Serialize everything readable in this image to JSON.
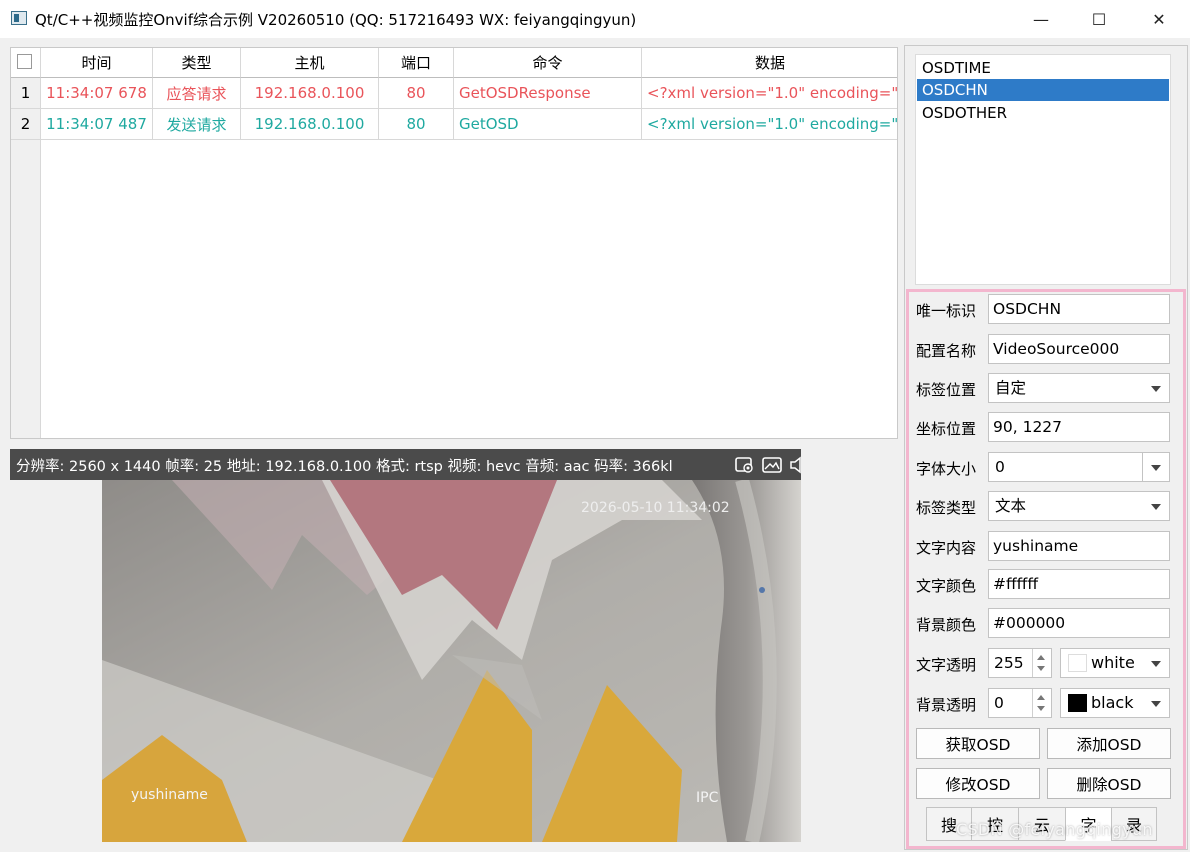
{
  "window": {
    "title": "Qt/C++视频监控Onvif综合示例 V20260510 (QQ: 517216493 WX: feiyangqingyun)",
    "min_glyph": "—",
    "max_glyph": "☐",
    "close_glyph": "✕"
  },
  "table": {
    "columns": [
      "时间",
      "类型",
      "主机",
      "端口",
      "命令",
      "数据"
    ],
    "rows": [
      {
        "index": "1",
        "time": "11:34:07 678",
        "type": "应答请求",
        "host": "192.168.0.100",
        "port": "80",
        "command": "GetOSDResponse",
        "data": "<?xml version=\"1.0\" encoding=\"",
        "color": "#e9545a"
      },
      {
        "index": "2",
        "time": "11:34:07 487",
        "type": "发送请求",
        "host": "192.168.0.100",
        "port": "80",
        "command": "GetOSD",
        "data": "<?xml version=\"1.0\" encoding=\"",
        "color": "#1fa9a0"
      }
    ]
  },
  "video": {
    "info": "分辨率: 2560 x 1440  帧率: 25  地址: 192.168.0.100  格式: rtsp  视频: hevc  音频: aac  码率: 366kl",
    "icons": [
      "record-icon",
      "snapshot-icon",
      "volume-icon",
      "record-dot-icon",
      "alarm-icon",
      "close-icon"
    ],
    "osd_time": "2026-05-10 11:34:02",
    "osd_name": "yushiname",
    "osd_other": "IPC"
  },
  "osd_list": {
    "items": [
      "OSDTIME",
      "OSDCHN",
      "OSDOTHER"
    ],
    "selected": "OSDCHN"
  },
  "form": {
    "id_label": "唯一标识",
    "id_value": "OSDCHN",
    "config_label": "配置名称",
    "config_value": "VideoSource000",
    "position_label": "标签位置",
    "position_value": "自定",
    "coord_label": "坐标位置",
    "coord_value": "90, 1227",
    "font_size_label": "字体大小",
    "font_size_value": "0",
    "label_type_label": "标签类型",
    "label_type_value": "文本",
    "text_content_label": "文字内容",
    "text_content_value": "yushiname",
    "text_color_label": "文字颜色",
    "text_color_value": "#ffffff",
    "bg_color_label": "背景颜色",
    "bg_color_value": "#000000",
    "text_alpha_label": "文字透明",
    "text_alpha_value": "255",
    "text_alpha_color": "white",
    "text_swatch": "#ffffff",
    "bg_alpha_label": "背景透明",
    "bg_alpha_value": "0",
    "bg_alpha_color": "black",
    "bg_swatch": "#000000"
  },
  "buttons": {
    "get": "获取OSD",
    "add": "添加OSD",
    "modify": "修改OSD",
    "delete": "删除OSD"
  },
  "tabs": [
    "搜",
    "控",
    "云",
    "字",
    "录"
  ],
  "active_tab": "字",
  "watermark": "CSDN @feiyangqingyun",
  "colors": {
    "selection": "#2e7bc8",
    "response_row": "#e9545a",
    "request_row": "#1fa9a0",
    "highlight_frame": "#f3b6ce"
  }
}
